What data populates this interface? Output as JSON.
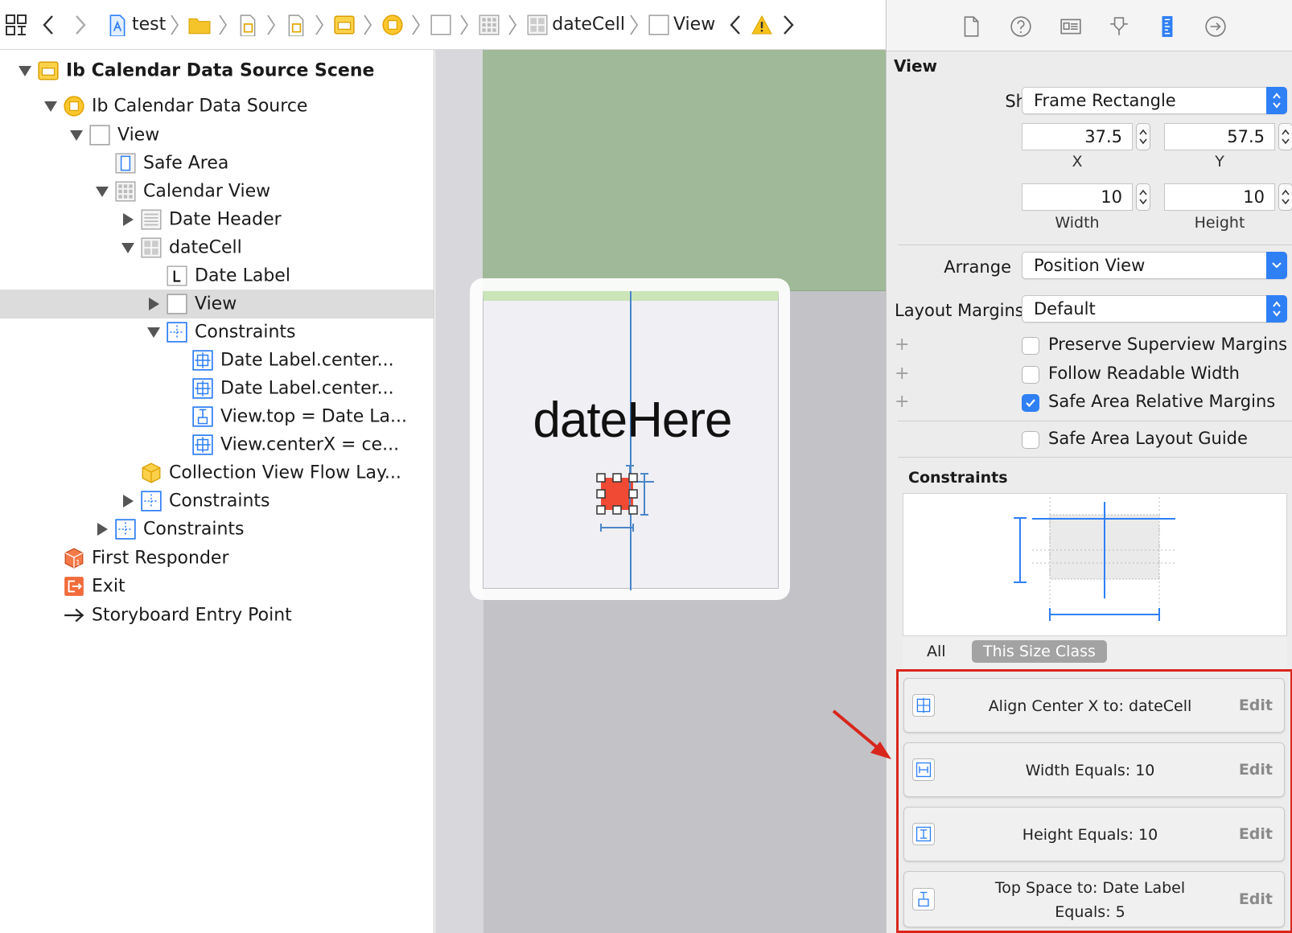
{
  "jumpbar": {
    "crumbs": [
      {
        "label": "test",
        "icon": "project-file-icon"
      },
      {
        "label": "",
        "icon": "folder-icon"
      },
      {
        "label": "",
        "icon": "storyboard-file-icon"
      },
      {
        "label": "",
        "icon": "storyboard-file-icon"
      },
      {
        "label": "",
        "icon": "scene-icon"
      },
      {
        "label": "",
        "icon": "object-icon"
      },
      {
        "label": "",
        "icon": "view-icon"
      },
      {
        "label": "",
        "icon": "collection-view-icon"
      },
      {
        "label": "dateCell",
        "icon": "collection-cell-icon"
      },
      {
        "label": "View",
        "icon": "view-icon"
      }
    ],
    "warning_icon": "warning-icon"
  },
  "outline": {
    "items": [
      {
        "label": "Ib Calendar Data Source Scene",
        "level": 0,
        "expanded": true,
        "icon": "scene-icon",
        "bold": true
      },
      {
        "label": "Ib Calendar Data Source",
        "level": 1,
        "expanded": true,
        "icon": "object-icon"
      },
      {
        "label": "View",
        "level": 2,
        "expanded": true,
        "icon": "view-icon"
      },
      {
        "label": "Safe Area",
        "level": 3,
        "expanded": null,
        "icon": "safe-area-icon"
      },
      {
        "label": "Calendar View",
        "level": 3,
        "expanded": true,
        "icon": "collection-view-icon"
      },
      {
        "label": "Date Header",
        "level": 4,
        "expanded": false,
        "icon": "reusable-view-icon"
      },
      {
        "label": "dateCell",
        "level": 4,
        "expanded": true,
        "icon": "collection-cell-icon"
      },
      {
        "label": "Date Label",
        "level": 5,
        "expanded": null,
        "icon": "label-icon"
      },
      {
        "label": "View",
        "level": 5,
        "expanded": false,
        "icon": "view-icon",
        "selected": true
      },
      {
        "label": "Constraints",
        "level": 5,
        "expanded": true,
        "icon": "constraints-icon"
      },
      {
        "label": "Date Label.center...",
        "level": 6,
        "expanded": null,
        "icon": "align-constraint-icon"
      },
      {
        "label": "Date Label.center...",
        "level": 6,
        "expanded": null,
        "icon": "align-constraint-icon"
      },
      {
        "label": "View.top = Date La...",
        "level": 6,
        "expanded": null,
        "icon": "spacing-constraint-icon"
      },
      {
        "label": "View.centerX = ce...",
        "level": 6,
        "expanded": null,
        "icon": "align-constraint-icon"
      },
      {
        "label": "Collection View Flow Lay...",
        "level": 4,
        "expanded": null,
        "icon": "flow-layout-icon"
      },
      {
        "label": "Constraints",
        "level": 4,
        "expanded": false,
        "icon": "constraints-icon"
      },
      {
        "label": "Constraints",
        "level": 3,
        "expanded": false,
        "icon": "constraints-icon"
      },
      {
        "label": "First Responder",
        "level": 1,
        "expanded": null,
        "icon": "first-responder-icon"
      },
      {
        "label": "Exit",
        "level": 1,
        "expanded": null,
        "icon": "exit-icon"
      },
      {
        "label": "Storyboard Entry Point",
        "level": 1,
        "expanded": null,
        "icon": "entry-arrow-icon"
      }
    ]
  },
  "canvas": {
    "cell_text": "dateHere"
  },
  "inspector": {
    "tabs": [
      "file-inspector-icon",
      "help-icon",
      "identity-inspector-icon",
      "attributes-inspector-icon",
      "size-inspector-icon",
      "connections-inspector-icon"
    ],
    "active_tab": 4,
    "section_title": "View",
    "show_label": "Show",
    "show_value": "Frame Rectangle",
    "x_value": "37.5",
    "x_label": "X",
    "y_value": "57.5",
    "y_label": "Y",
    "width_value": "10",
    "width_label": "Width",
    "height_value": "10",
    "height_label": "Height",
    "arrange_label": "Arrange",
    "arrange_value": "Position View",
    "layout_margins_label": "Layout Margins",
    "layout_margins_value": "Default",
    "checkboxes": [
      {
        "label": "Preserve Superview Margins",
        "checked": false
      },
      {
        "label": "Follow Readable Width",
        "checked": false
      },
      {
        "label": "Safe Area Relative Margins",
        "checked": true
      },
      {
        "label": "Safe Area Layout Guide",
        "checked": false
      }
    ],
    "constraints_title": "Constraints",
    "size_class_all": "All",
    "size_class_this": "This Size Class",
    "constraints": [
      {
        "lines": [
          "Align Center X to:  dateCell"
        ],
        "edit": "Edit",
        "icon": "align-center-x-icon"
      },
      {
        "lines": [
          "Width Equals:  10"
        ],
        "edit": "Edit",
        "icon": "width-constraint-icon"
      },
      {
        "lines": [
          "Height Equals:  10"
        ],
        "edit": "Edit",
        "icon": "height-constraint-icon"
      },
      {
        "lines": [
          "Top Space to:  Date Label",
          "Equals:  5"
        ],
        "edit": "Edit",
        "icon": "top-space-icon"
      }
    ]
  },
  "colors": {
    "accent": "#2f7ff5",
    "highlight": "#d9261c",
    "canvas_green": "#a0b998",
    "selected_view": "#f04a35"
  }
}
